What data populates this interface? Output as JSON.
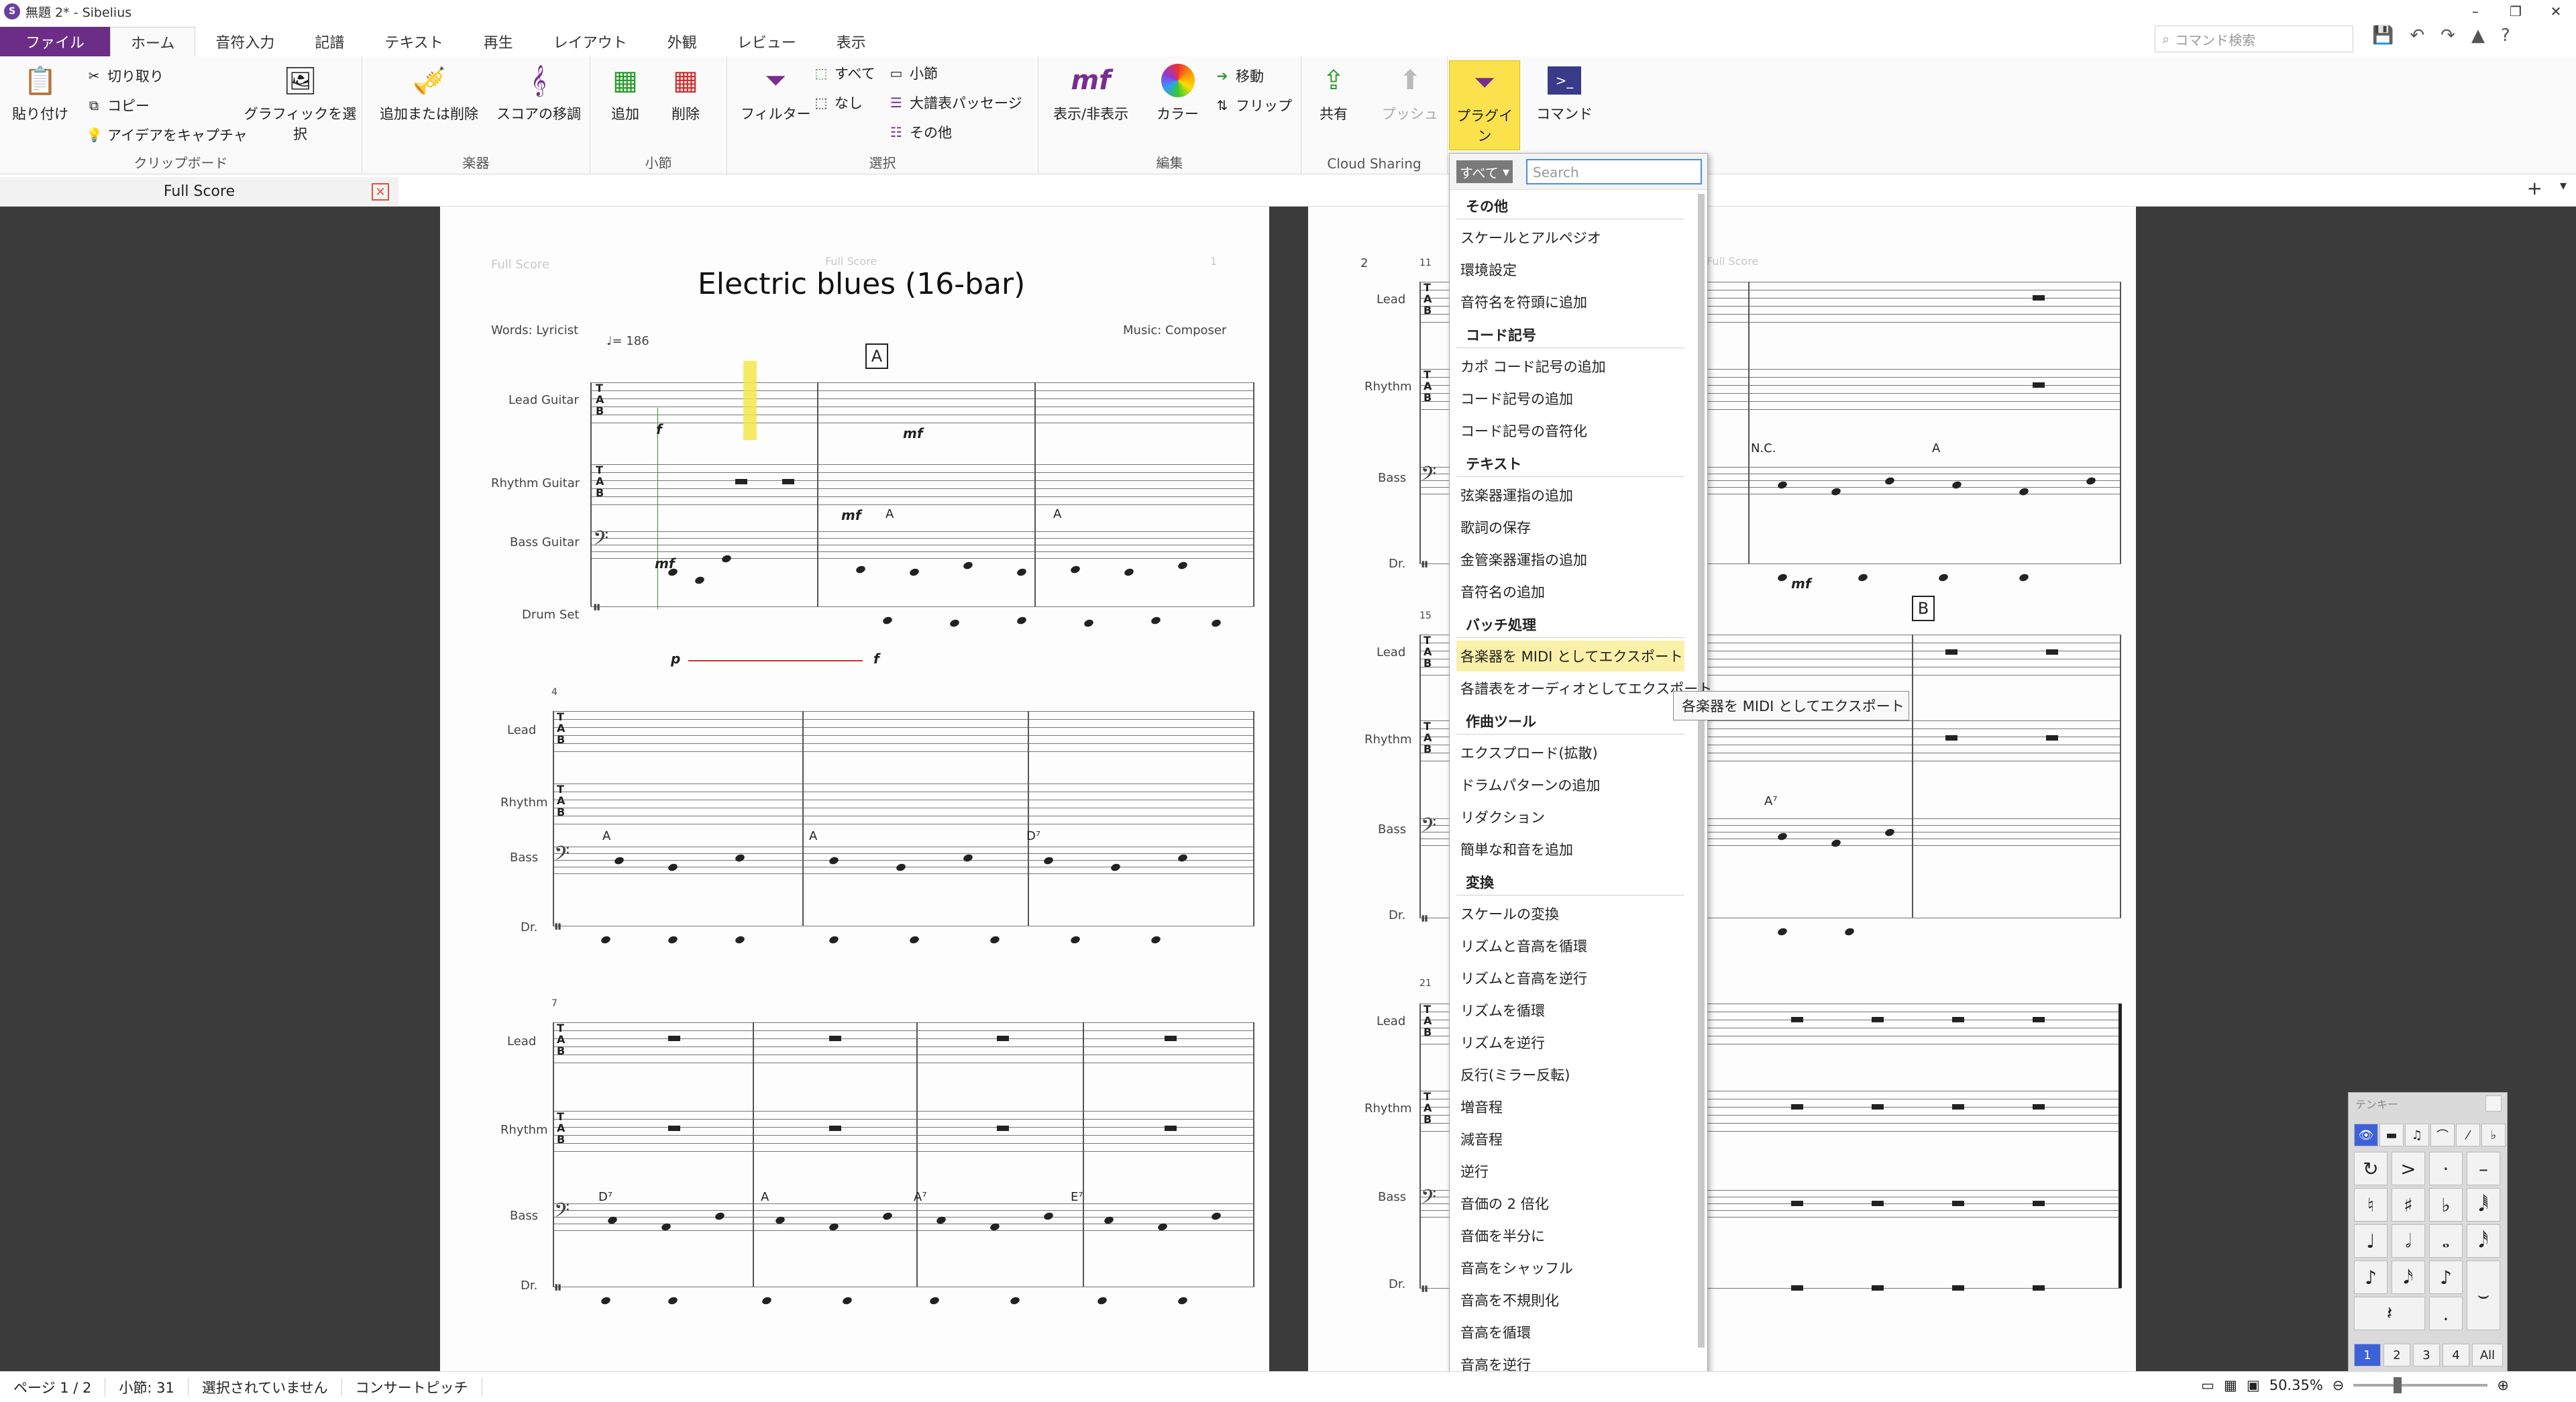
{
  "window": {
    "title": "無題 2* - Sibelius",
    "logo": "S"
  },
  "tabs": [
    "ファイル",
    "ホーム",
    "音符入力",
    "記譜",
    "テキスト",
    "再生",
    "レイアウト",
    "外観",
    "レビュー",
    "表示"
  ],
  "command_search": {
    "placeholder": "コマンド検索"
  },
  "ribbon": {
    "clipboard": {
      "paste": "貼り付け",
      "cut": "切り取り",
      "copy": "コピー",
      "capture": "アイデアをキャプチャ",
      "select_graphic": "グラフィックを選択",
      "label": "クリップボード"
    },
    "instruments": {
      "add_remove": "追加または削除",
      "transpose": "スコアの移調",
      "label": "楽器"
    },
    "bars": {
      "add": "追加",
      "delete": "削除",
      "label": "小節"
    },
    "select": {
      "filter": "フィルター",
      "all": "すべて",
      "none": "なし",
      "bar": "小節",
      "passage": "大譜表パッセージ",
      "other": "その他",
      "label": "選択"
    },
    "edit": {
      "show_hide": "表示/非表示",
      "color": "カラー",
      "move": "移動",
      "flip": "フリップ",
      "label": "編集"
    },
    "cloud": {
      "share": "共有",
      "push": "プッシュ",
      "label": "Cloud Sharing"
    },
    "plugins": {
      "label": "プラグイン"
    },
    "command": {
      "label": "コマンド"
    }
  },
  "doc_tab": {
    "label": "Full Score"
  },
  "page1": {
    "header_left": "Full Score",
    "header_center": "Full Score",
    "page_num": "1",
    "title": "Electric blues (16-bar)",
    "words": "Words: Lyricist",
    "music": "Music: Composer",
    "tempo": "♩= 186",
    "rehearsal_a": "A",
    "sys1": [
      "Lead Guitar",
      "Rhythm Guitar",
      "Bass Guitar",
      "Drum Set"
    ],
    "sys2": [
      "Lead",
      "Rhythm",
      "Bass",
      "Dr."
    ],
    "sys3": [
      "Lead",
      "Rhythm",
      "Bass",
      "Dr."
    ],
    "bar4": "4",
    "bar7": "7",
    "dyn_f": "f",
    "dyn_mf": "mf",
    "dyn_p": "p",
    "chords_sys2": [
      "A",
      "A",
      "D⁷"
    ],
    "chords_sys3": [
      "D⁷",
      "A",
      "A⁷",
      "E⁷"
    ]
  },
  "page2": {
    "page_num": "2",
    "header": "Full Score",
    "sys1": [
      "Lead",
      "Rhythm",
      "Bass",
      "Dr."
    ],
    "sys2": [
      "Lead",
      "Rhythm",
      "Bass",
      "Dr."
    ],
    "sys3": [
      "Lead",
      "Rhythm",
      "Bass",
      "Dr."
    ],
    "bar11": "11",
    "bar15": "15",
    "bar21": "21",
    "nc": "N.C.",
    "chord_a": "A",
    "chord_a7": "A⁷",
    "rehearsal_b": "B"
  },
  "plugin_menu": {
    "filter": "すべて",
    "search_placeholder": "Search",
    "sections": [
      {
        "title": "その他",
        "items": [
          "スケールとアルペジオ",
          "環境設定",
          "音符名を符頭に追加"
        ]
      },
      {
        "title": "コード記号",
        "items": [
          "カポ コード記号の追加",
          "コード記号の追加",
          "コード記号の音符化"
        ]
      },
      {
        "title": "テキスト",
        "items": [
          "弦楽器運指の追加",
          "歌詞の保存",
          "金管楽器運指の追加",
          "音符名の追加"
        ]
      },
      {
        "title": "バッチ処理",
        "items": [
          "各楽器を MIDI としてエクスポート",
          "各譜表をオーディオとしてエクスポート"
        ]
      },
      {
        "title": "作曲ツール",
        "items": [
          "エクスプロード(拡散)",
          "ドラムパターンの追加",
          "リダクション",
          "簡単な和音を追加"
        ]
      },
      {
        "title": "変換",
        "items": [
          "スケールの変換",
          "リズムと音高を循環",
          "リズムと音高を逆行",
          "リズムを循環",
          "リズムを逆行",
          "反行(ミラー反転)",
          "増音程",
          "減音程",
          "逆行",
          "音価の 2 倍化",
          "音価を半分に",
          "音高をシャッフル",
          "音高を不規則化",
          "音高を循環",
          "音高を逆行"
        ]
      }
    ],
    "highlighted": "各楽器を MIDI としてエクスポート",
    "tooltip": "各楽器を MIDI としてエクスポート"
  },
  "keypad": {
    "title": "テンキー",
    "row_top": [
      "1",
      "2",
      "3",
      "4",
      "All"
    ]
  },
  "status": {
    "page": "ページ 1 / 2",
    "bars": "小節: 31",
    "selection": "選択されていません",
    "pitch": "コンサートピッチ",
    "zoom": "50.35%"
  }
}
